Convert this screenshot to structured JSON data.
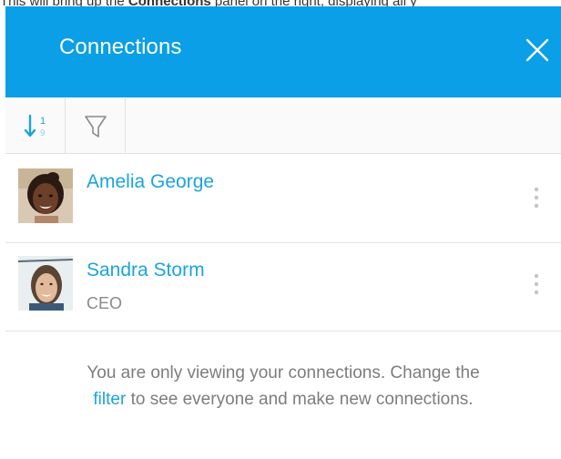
{
  "doc": {
    "intro_before": "This will bring up the ",
    "intro_bold": "Connections",
    "intro_after": " panel on the right, displaying all y"
  },
  "panel": {
    "title": "Connections",
    "header_color": "#0a9fe6",
    "link_color": "#1ca3e0"
  },
  "toolbar": {
    "sort_icon": "sort-numeric-icon",
    "sort_digit_top": "1",
    "sort_digit_bottom": "9",
    "filter_icon": "filter-funnel-icon"
  },
  "connections": [
    {
      "name": "Amelia George",
      "role": "",
      "menu_icon": "kebab-menu-icon"
    },
    {
      "name": "Sandra Storm",
      "role": "CEO",
      "menu_icon": "kebab-menu-icon"
    }
  ],
  "notice": {
    "line1": "You are only viewing your connections. Change the",
    "link_text": "filter",
    "line2_rest": " to see everyone and make new connections."
  }
}
